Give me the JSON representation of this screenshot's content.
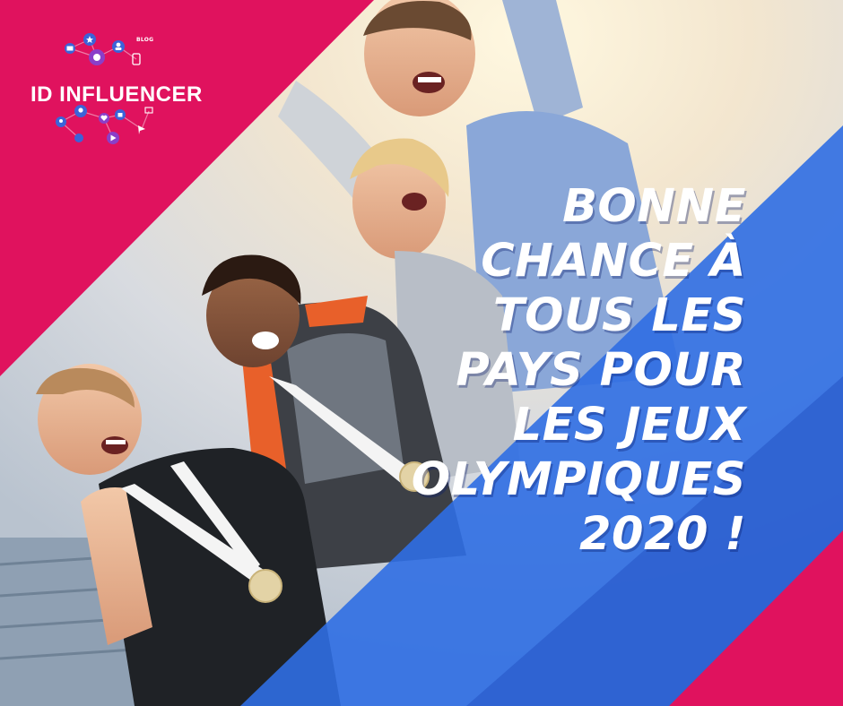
{
  "brand": {
    "name": "ID INFLUENCER",
    "blog_label": "BLOG"
  },
  "headline": {
    "lines": [
      "BONNE",
      "CHANCE À",
      "TOUS LES",
      "PAYS POUR",
      "LES JEUX",
      "OLYMPIQUES",
      "2020 !"
    ]
  },
  "colors": {
    "magenta": "#e0125e",
    "blue": "#2f6ee3",
    "navy": "#233f91",
    "text": "#ffffff"
  },
  "icons": [
    "envelope-icon",
    "star-icon",
    "user-icon",
    "phone-icon",
    "lightbulb-icon",
    "heart-icon",
    "thumbs-up-icon",
    "play-icon",
    "paper-plane-icon",
    "image-icon"
  ]
}
